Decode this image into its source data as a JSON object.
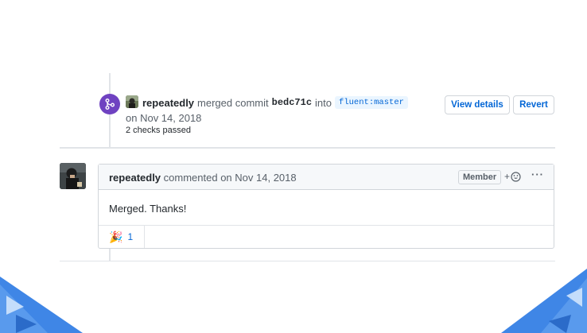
{
  "merge_event": {
    "user": "repeatedly",
    "action": "merged commit",
    "commit": "bedc71c",
    "into": "into",
    "branch": "fluent:master",
    "date": "on Nov 14, 2018",
    "checks": "2 checks passed",
    "view_details_label": "View details",
    "revert_label": "Revert",
    "badge_icon": "git-merge-icon"
  },
  "comment": {
    "author": "repeatedly",
    "meta": "commented on Nov 14, 2018",
    "role_badge": "Member",
    "add_reaction": "+",
    "more_actions": "···",
    "body": "Merged. Thanks!",
    "reaction_emoji": "🎉",
    "reaction_count": "1"
  },
  "colors": {
    "merge_purple": "#6f42c1",
    "link_blue": "#0366d6",
    "corner_blue": "#2f7be0"
  }
}
